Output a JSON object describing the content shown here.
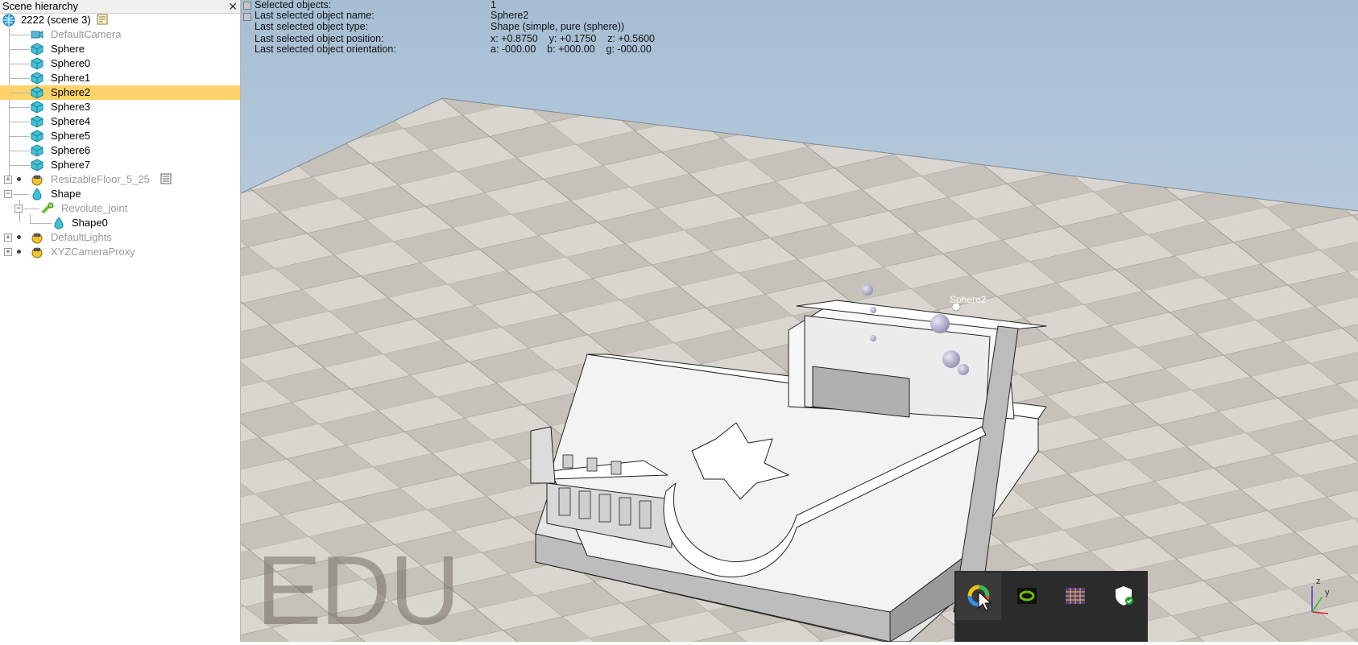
{
  "hierarchy": {
    "title": "Scene hierarchy",
    "close_glyph": "✕",
    "root": "2222 (scene 3)",
    "items": [
      {
        "label": "DefaultCamera",
        "dim": true
      },
      {
        "label": "Sphere"
      },
      {
        "label": "Sphere0"
      },
      {
        "label": "Sphere1"
      },
      {
        "label": "Sphere2",
        "selected": true
      },
      {
        "label": "Sphere3"
      },
      {
        "label": "Sphere4"
      },
      {
        "label": "Sphere5"
      },
      {
        "label": "Sphere6"
      },
      {
        "label": "Sphere7"
      },
      {
        "label": "ResizableFloor_5_25",
        "dim": true
      },
      {
        "label": "Shape"
      },
      {
        "label": "Revolute_joint",
        "dim": true
      },
      {
        "label": "Shape0"
      },
      {
        "label": "DefaultLights",
        "dim": true
      },
      {
        "label": "XYZCameraProxy",
        "dim": true
      }
    ]
  },
  "info": {
    "labels": [
      "Selected objects:",
      "Last selected object name:",
      "Last selected object type:",
      "Last selected object position:",
      "Last selected object orientation:"
    ],
    "values": [
      "1",
      "Sphere2",
      "Shape (simple, pure (sphere))",
      "x: +0.8750    y: +0.1750    z: +0.5600",
      "a: -000.00    b: +000.00    g: -000.00"
    ]
  },
  "viewport": {
    "watermark": "EDU",
    "object_label": "Sphere2",
    "axis_z": "z",
    "axis_y": "y"
  },
  "tray": {
    "icons": [
      "colorful-ring-app-icon",
      "nvidia-icon",
      "color-grid-icon",
      "windows-security-icon"
    ]
  },
  "colors": {
    "selection": "#ffd36b",
    "sky_top": "#a6bed3",
    "sky_bottom": "#d8e1ea",
    "tile_light": "#d9d6cf",
    "tile_dark": "#c6c2b9"
  }
}
